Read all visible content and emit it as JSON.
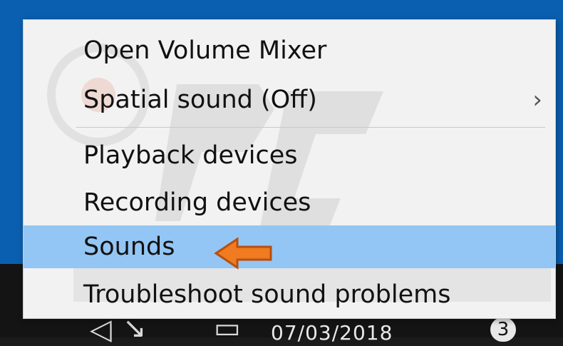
{
  "menu": {
    "items": [
      {
        "label": "Open Volume Mixer"
      },
      {
        "label": "Spatial sound (Off)",
        "submenu_glyph": "›"
      },
      {
        "label": "Playback devices"
      },
      {
        "label": "Recording devices"
      },
      {
        "label": "Sounds"
      },
      {
        "label": "Troubleshoot sound problems"
      }
    ]
  },
  "taskbar": {
    "date": "07/03/2018",
    "notifications": "3"
  },
  "colors": {
    "desktop": "#0a5fb0",
    "taskbar": "#141414",
    "menu_background": "#f2f2f2",
    "selected_row": "#93c6f4",
    "callout_arrow": "#f07b20"
  }
}
